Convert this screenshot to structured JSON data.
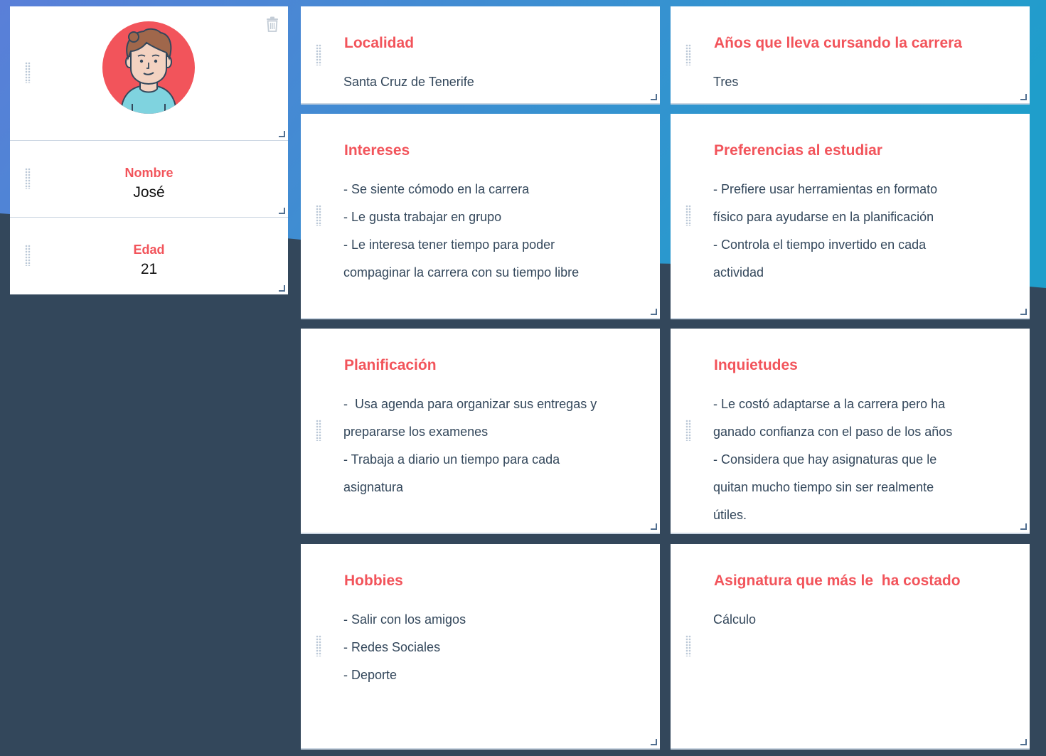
{
  "colors": {
    "accent": "#f2545b",
    "background_dark": "#33475b",
    "gradient_start": "#5a7fd8",
    "gradient_end": "#1f9ecb",
    "card": "#ffffff",
    "text": "#33475b",
    "avatar_bg": "#f2545b",
    "avatar_shirt": "#7fd3df"
  },
  "icons": {
    "delete": "trash-icon",
    "drag": "drag-handle-icon",
    "resize": "resize-handle-icon",
    "avatar": "male-avatar-icon"
  },
  "profile": {
    "name_label": "Nombre",
    "name_value": "José",
    "age_label": "Edad",
    "age_value": "21"
  },
  "cards": {
    "localidad": {
      "title": "Localidad",
      "lines": [
        "Santa Cruz de Tenerife"
      ]
    },
    "anios": {
      "title": "Años que lleva cursando la carrera",
      "lines": [
        "Tres"
      ]
    },
    "intereses": {
      "title": "Intereses",
      "lines": [
        "- Se siente cómodo en la carrera",
        "- Le gusta trabajar en grupo",
        "- Le interesa tener tiempo para poder",
        "compaginar la carrera con su tiempo libre"
      ]
    },
    "preferencias": {
      "title": "Preferencias al estudiar",
      "lines": [
        "- Prefiere usar herramientas en formato",
        "físico para ayudarse en la planificación",
        "- Controla el tiempo invertido en cada",
        "actividad"
      ]
    },
    "planificacion": {
      "title": "Planificación",
      "lines": [
        "-  Usa agenda para organizar sus entregas y",
        "prepararse los examenes",
        "- Trabaja a diario un tiempo para cada",
        "asignatura"
      ]
    },
    "inquietudes": {
      "title": "Inquietudes",
      "lines": [
        "- Le costó adaptarse a la carrera pero ha",
        "ganado confianza con el paso de los años",
        "- Considera que hay asignaturas que le",
        "quitan mucho tiempo sin ser realmente",
        "útiles."
      ]
    },
    "hobbies": {
      "title": "Hobbies",
      "lines": [
        "- Salir con los amigos",
        "- Redes Sociales",
        "- Deporte"
      ]
    },
    "asignatura": {
      "title": "Asignatura que más le  ha costado",
      "lines": [
        "Cálculo"
      ]
    }
  }
}
